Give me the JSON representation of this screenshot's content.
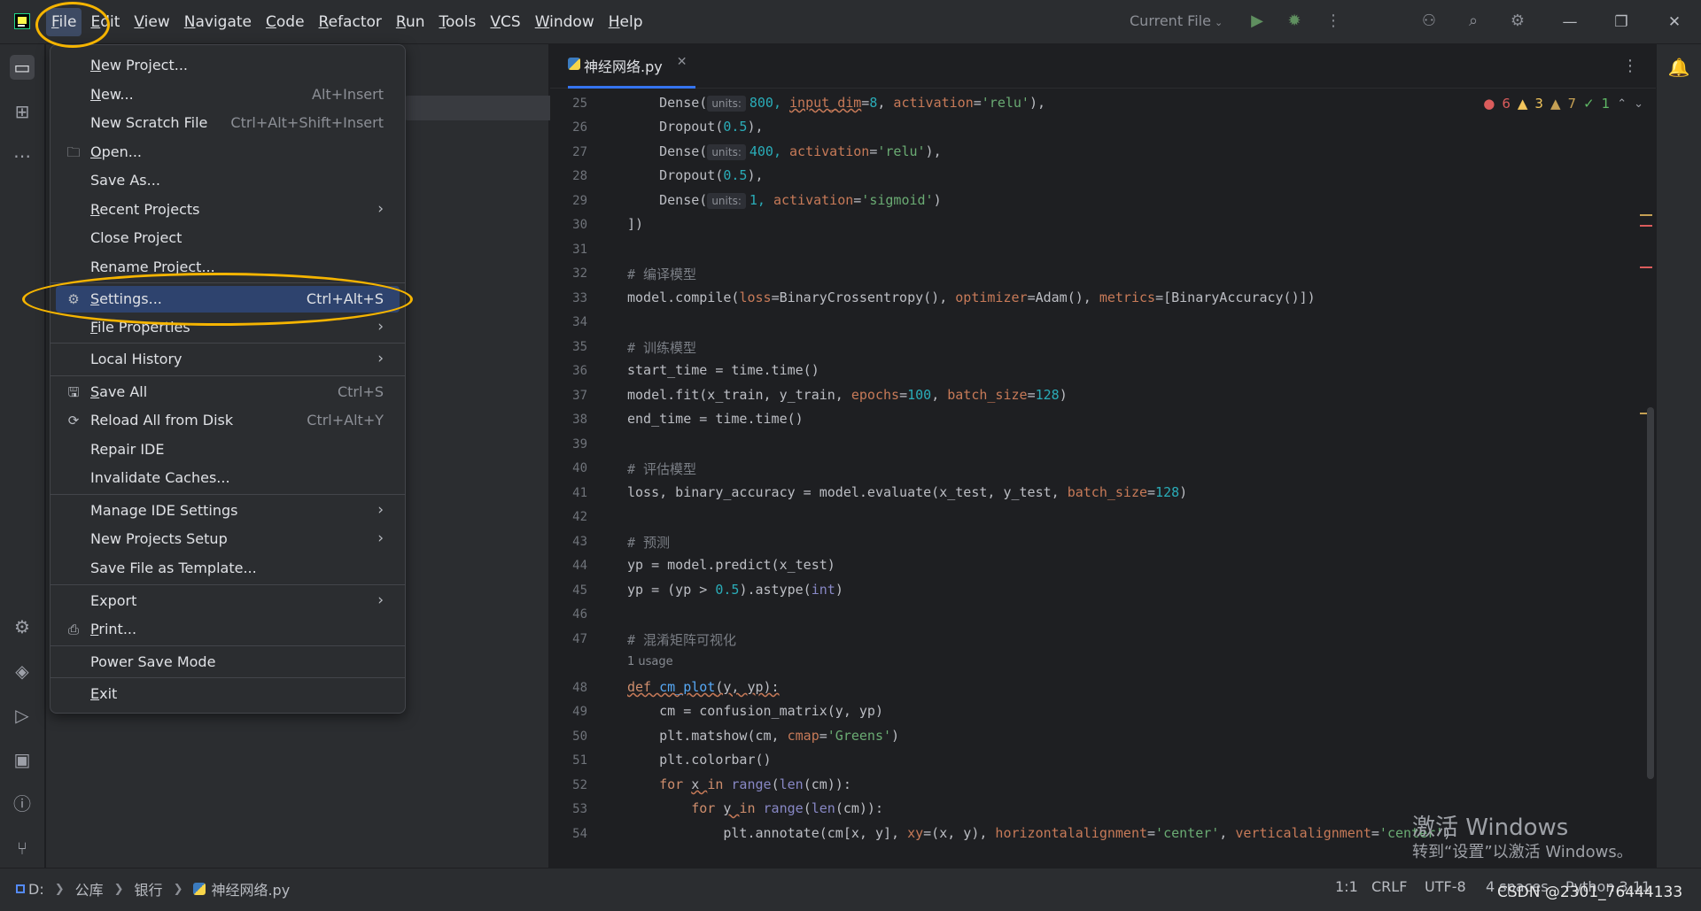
{
  "menubar": {
    "items": [
      "File",
      "Edit",
      "View",
      "Navigate",
      "Code",
      "Refactor",
      "Run",
      "Tools",
      "VCS",
      "Window",
      "Help"
    ]
  },
  "toolbar": {
    "run_config": "Current File",
    "icons": [
      "run-icon",
      "debug-icon",
      "more-icon",
      "add-user-icon",
      "search-icon",
      "settings-icon"
    ]
  },
  "window_controls": [
    "minimize-icon",
    "restore-icon",
    "close-icon"
  ],
  "file_menu": {
    "items": [
      {
        "label": "New Project...",
        "shortcut": ""
      },
      {
        "label": "New...",
        "shortcut": "Alt+Insert"
      },
      {
        "label": "New Scratch File",
        "shortcut": "Ctrl+Alt+Shift+Insert"
      },
      {
        "label": "Open...",
        "shortcut": "",
        "icon": "folder-icon"
      },
      {
        "label": "Save As...",
        "shortcut": ""
      },
      {
        "label": "Recent Projects",
        "submenu": true
      },
      {
        "label": "Close Project",
        "shortcut": ""
      },
      {
        "label": "Rename Project...",
        "shortcut": ""
      },
      {
        "label": "Settings...",
        "shortcut": "Ctrl+Alt+S",
        "icon": "gear-icon"
      },
      {
        "label": "File Properties",
        "submenu": true
      },
      {
        "label": "Local History",
        "submenu": true
      },
      {
        "label": "Save All",
        "shortcut": "Ctrl+S",
        "icon": "save-icon"
      },
      {
        "label": "Reload All from Disk",
        "shortcut": "Ctrl+Alt+Y",
        "icon": "reload-icon"
      },
      {
        "label": "Repair IDE",
        "shortcut": ""
      },
      {
        "label": "Invalidate Caches...",
        "shortcut": ""
      },
      {
        "label": "Manage IDE Settings",
        "submenu": true
      },
      {
        "label": "New Projects Setup",
        "submenu": true
      },
      {
        "label": "Save File as Template...",
        "shortcut": ""
      },
      {
        "label": "Export",
        "submenu": true
      },
      {
        "label": "Print...",
        "shortcut": "",
        "icon": "printer-icon"
      },
      {
        "label": "Power Save Mode",
        "shortcut": ""
      },
      {
        "label": "Exit",
        "shortcut": ""
      }
    ]
  },
  "editor": {
    "tab_label": "神经网络.py",
    "inspections": {
      "errors": "6",
      "warnings": "3",
      "weak_warnings": "7",
      "ok": "1"
    },
    "line_numbers": [
      "25",
      "26",
      "27",
      "28",
      "29",
      "30",
      "31",
      "32",
      "33",
      "34",
      "35",
      "36",
      "37",
      "38",
      "39",
      "40",
      "41",
      "42",
      "43",
      "44",
      "45",
      "46",
      "47",
      "48",
      "49",
      "50",
      "51",
      "52",
      "53",
      "54"
    ],
    "usage_hint": "1 usage",
    "inlay_hint": "units:",
    "code": {
      "l25": [
        "    Dense(",
        "800, ",
        "input_dim",
        "=",
        "8",
        ", ",
        "activation",
        "=",
        "'relu'",
        "),"
      ],
      "l26": [
        "    Dropout(",
        "0.5",
        "),"
      ],
      "l27": [
        "    Dense(",
        "400, ",
        "activation",
        "=",
        "'relu'",
        "),"
      ],
      "l28": [
        "    Dropout(",
        "0.5",
        "),"
      ],
      "l29": [
        "    Dense(",
        "1, ",
        "activation",
        "=",
        "'sigmoid'",
        ")"
      ],
      "l30": "])",
      "l32": "# 编译模型",
      "l33": [
        "model.compile(",
        "loss",
        "=BinaryCrossentropy(), ",
        "optimizer",
        "=Adam(), ",
        "metrics",
        "=[BinaryAccuracy()])"
      ],
      "l35": "# 训练模型",
      "l36": "start_time = time.time()",
      "l37": [
        "model.fit(x_train, y_train, ",
        "epochs",
        "=",
        "100",
        ", ",
        "batch_size",
        "=",
        "128",
        ")"
      ],
      "l38": "end_time = time.time()",
      "l40": "# 评估模型",
      "l41": [
        "loss, binary_accuracy = model.evaluate(x_test, y_test, ",
        "batch_size",
        "=",
        "128",
        ")"
      ],
      "l43": "# 预测",
      "l44": "yp = model.predict(x_test)",
      "l45": [
        "yp = (yp > ",
        "0.5",
        ").astype(",
        "int",
        ")"
      ],
      "l47": "# 混淆矩阵可视化",
      "l48": [
        "def ",
        "cm_plot",
        "(y, yp):"
      ],
      "l49": "    cm = confusion_matrix(y, yp)",
      "l50": [
        "    plt.matshow(cm, ",
        "cmap",
        "=",
        "'Greens'",
        ")"
      ],
      "l51": "    plt.colorbar()",
      "l52": [
        "    ",
        "for ",
        "x ",
        "in ",
        "range",
        "(",
        "len",
        "(cm)):"
      ],
      "l53": [
        "        ",
        "for ",
        "y ",
        "in ",
        "range",
        "(",
        "len",
        "(cm)):"
      ],
      "l54": [
        "            plt.annotate(cm[x, y], ",
        "xy",
        "=(x, y), ",
        "horizontalalignment",
        "=",
        "'center'",
        ", ",
        "verticalalignment",
        "=",
        "'center'",
        ")"
      ]
    }
  },
  "statusbar": {
    "breadcrumb": [
      "D:",
      "公库",
      "银行",
      "神经网络.py"
    ],
    "position": "1:1",
    "line_sep": "CRLF",
    "encoding": "UTF-8",
    "indent": "4 spaces",
    "interpreter": "Python 3.11"
  },
  "watermarks": {
    "activate_line1": "激活 Windows",
    "activate_line2": "转到“设置”以激活 Windows。",
    "csdn": "CSDN @2301_76444133"
  },
  "colors": {
    "accent": "#3574f0",
    "highlight": "#2e436e",
    "annotation": "#f5b400",
    "error": "#db5c5c",
    "warning": "#f2c55c"
  }
}
